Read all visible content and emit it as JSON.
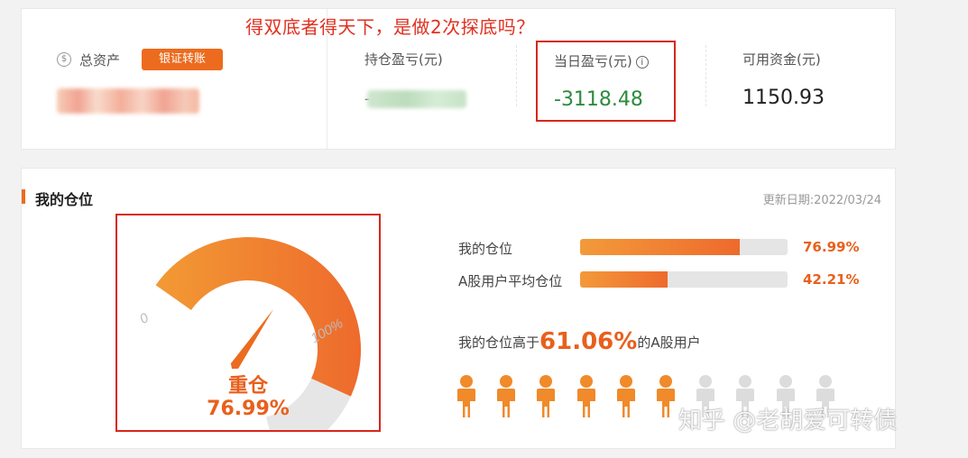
{
  "annotation": "得双底者得天下，是做2次探底吗？",
  "summary": {
    "total_assets": {
      "label": "总资产",
      "icon": "coin-icon",
      "button": "银证转账"
    },
    "holding_pnl": {
      "label": "持仓盈亏(元)",
      "value_prefix": "-"
    },
    "daily_pnl": {
      "label": "当日盈亏(元)",
      "icon": "info-icon",
      "value": "-3118.48"
    },
    "available_cash": {
      "label": "可用资金(元)",
      "value": "1150.93"
    }
  },
  "position": {
    "title": "我的仓位",
    "update_date": "更新日期:2022/03/24",
    "gauge": {
      "min_label": "0",
      "max_label": "100%",
      "level": 76.99,
      "status": "重仓",
      "value_text": "76.99%"
    },
    "bars": [
      {
        "label": "我的仓位",
        "percent": 76.99,
        "value_text": "76.99%"
      },
      {
        "label": "A股用户平均仓位",
        "percent": 42.21,
        "value_text": "42.21%"
      }
    ],
    "compare": {
      "prefix": "我的仓位高于",
      "value": "61.06%",
      "suffix": "的A股用户"
    },
    "people": {
      "total": 10,
      "highlighted": 6,
      "icon": "person-icon"
    }
  },
  "watermark": "知乎 @老胡爱可转债",
  "colors": {
    "accent": "#ec6b1e",
    "loss_green": "#2e8b3e",
    "highlight_box": "#d9261c",
    "inactive": "#e5e5e5"
  }
}
